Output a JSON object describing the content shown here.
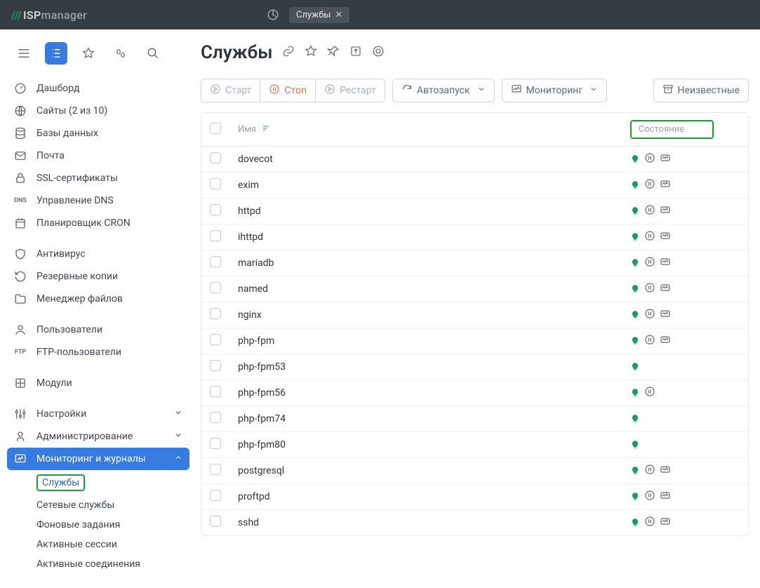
{
  "topbar": {
    "logo_isp": "ISP",
    "logo_manager": "manager",
    "tab_label": "Службы"
  },
  "sidebar": {
    "dashboard": "Дашборд",
    "sites": "Сайты (2 из 10)",
    "db": "Базы данных",
    "mail": "Почта",
    "ssl": "SSL-сертификаты",
    "dns": "Управление DNS",
    "cron": "Планировщик CRON",
    "antivirus": "Антивирус",
    "backup": "Резервные копии",
    "files": "Менеджер файлов",
    "users": "Пользователи",
    "ftp": "FTP-пользователи",
    "modules": "Модули",
    "settings": "Настройки",
    "admin": "Администрирование",
    "monitoring": "Мониторинг и журналы",
    "monitoring_sub": {
      "services": "Службы",
      "net": "Сетевые службы",
      "bg": "Фоновые задания",
      "sessions": "Активные сессии",
      "conn": "Активные соединения"
    }
  },
  "page": {
    "title": "Службы"
  },
  "toolbar": {
    "start": "Старт",
    "stop": "Стоп",
    "restart": "Рестарт",
    "autostart": "Автозапуск",
    "monitoring": "Мониторинг",
    "unknown": "Неизвестные"
  },
  "table": {
    "col_name": "Имя",
    "col_state": "Состояние",
    "rows": [
      {
        "name": "dovecot",
        "bulb": true,
        "autostart": true,
        "monitor": true
      },
      {
        "name": "exim",
        "bulb": true,
        "autostart": true,
        "monitor": true
      },
      {
        "name": "httpd",
        "bulb": true,
        "autostart": true,
        "monitor": true
      },
      {
        "name": "ihttpd",
        "bulb": true,
        "autostart": true,
        "monitor": true
      },
      {
        "name": "mariadb",
        "bulb": true,
        "autostart": true,
        "monitor": true
      },
      {
        "name": "named",
        "bulb": true,
        "autostart": true,
        "monitor": true
      },
      {
        "name": "nginx",
        "bulb": true,
        "autostart": true,
        "monitor": true
      },
      {
        "name": "php-fpm",
        "bulb": true,
        "autostart": true,
        "monitor": true
      },
      {
        "name": "php-fpm53",
        "bulb": true,
        "autostart": false,
        "monitor": false
      },
      {
        "name": "php-fpm56",
        "bulb": true,
        "autostart": true,
        "monitor": false
      },
      {
        "name": "php-fpm74",
        "bulb": true,
        "autostart": false,
        "monitor": false
      },
      {
        "name": "php-fpm80",
        "bulb": true,
        "autostart": false,
        "monitor": false
      },
      {
        "name": "postgresql",
        "bulb": true,
        "autostart": true,
        "monitor": true
      },
      {
        "name": "proftpd",
        "bulb": true,
        "autostart": true,
        "monitor": true
      },
      {
        "name": "sshd",
        "bulb": true,
        "autostart": true,
        "monitor": true
      }
    ]
  }
}
